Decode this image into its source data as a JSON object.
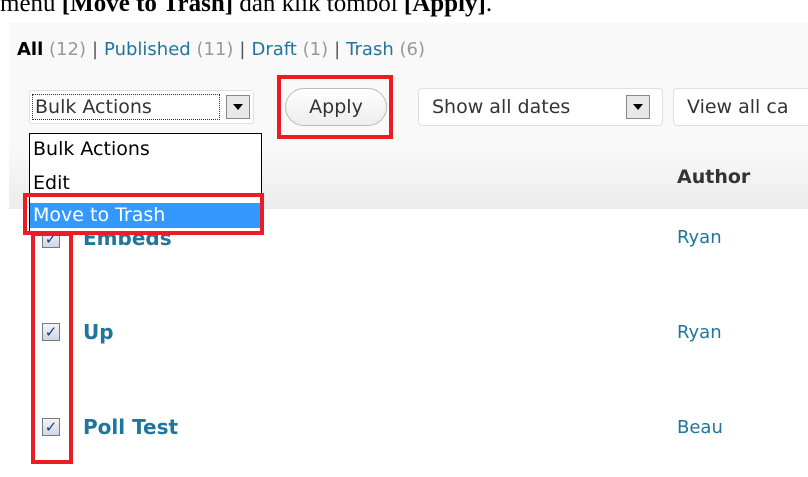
{
  "instruction": {
    "prefix": "menu ",
    "bold1": "[Move to Trash]",
    "middle": " dan klik tombol ",
    "bold2": "[Apply]",
    "suffix": "."
  },
  "filters": {
    "all": "All",
    "all_count": "(12)",
    "published": "Published",
    "published_count": "(11)",
    "draft": "Draft",
    "draft_count": "(1)",
    "trash": "Trash",
    "trash_count": "(6)",
    "separator": "|"
  },
  "toolbar": {
    "bulk_actions_value": "Bulk Actions",
    "apply_label": "Apply",
    "dates_value": "Show all dates",
    "categories_value": "View all ca"
  },
  "bulk_menu": {
    "options": [
      "Bulk Actions",
      "Edit",
      "Move to Trash"
    ],
    "selected_index": 2
  },
  "table": {
    "author_header": "Author",
    "rows": [
      {
        "title": "Embeds",
        "author": "Ryan",
        "checked": true
      },
      {
        "title": "Up",
        "author": "Ryan",
        "checked": true
      },
      {
        "title": "Poll Test",
        "author": "Beau",
        "checked": true
      }
    ]
  },
  "colors": {
    "link": "#21759b",
    "highlight": "#ec1c24",
    "selected_option": "#3399ff"
  },
  "icons": {
    "checkbox_mark": "✓"
  }
}
